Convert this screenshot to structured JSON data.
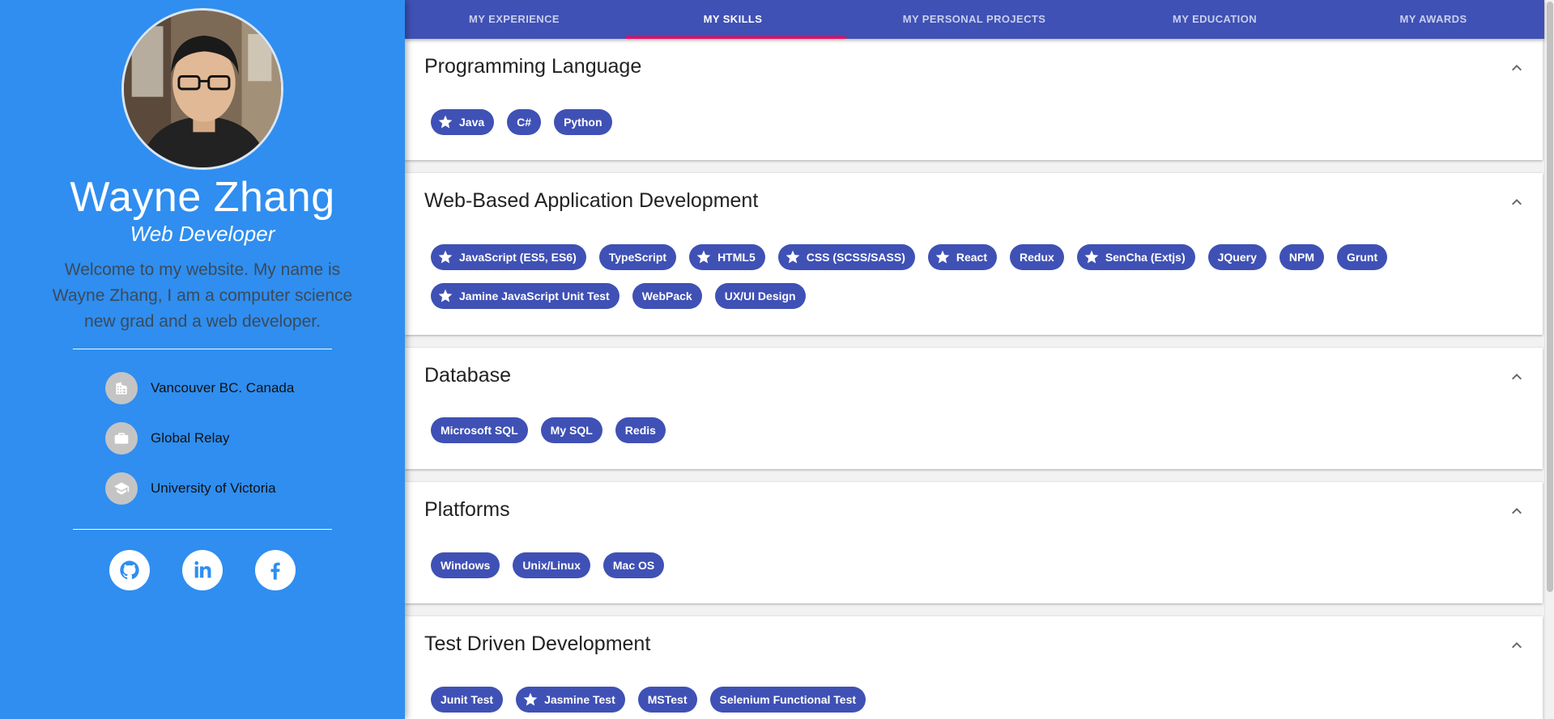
{
  "profile": {
    "name": "Wayne Zhang",
    "role": "Web Developer",
    "bio": "Welcome to my website. My name is Wayne Zhang, I am a computer science new grad and a web developer.",
    "info": [
      {
        "icon": "building-icon",
        "text": "Vancouver BC. Canada"
      },
      {
        "icon": "briefcase-icon",
        "text": "Global Relay"
      },
      {
        "icon": "graduation-cap-icon",
        "text": "University of Victoria"
      }
    ],
    "social": [
      "github-icon",
      "linkedin-icon",
      "facebook-icon"
    ]
  },
  "nav": {
    "tabs": [
      "MY EXPERIENCE",
      "MY SKILLS",
      "MY PERSONAL PROJECTS",
      "MY EDUCATION",
      "MY AWARDS"
    ],
    "active": "MY SKILLS"
  },
  "skills": [
    {
      "title": "Programming Language",
      "chips": [
        {
          "label": "Java",
          "star": true
        },
        {
          "label": "C#",
          "star": false
        },
        {
          "label": "Python",
          "star": false
        }
      ]
    },
    {
      "title": "Web-Based Application Development",
      "chips": [
        {
          "label": "JavaScript (ES5, ES6)",
          "star": true
        },
        {
          "label": "TypeScript",
          "star": false
        },
        {
          "label": "HTML5",
          "star": true
        },
        {
          "label": "CSS (SCSS/SASS)",
          "star": true
        },
        {
          "label": "React",
          "star": true
        },
        {
          "label": "Redux",
          "star": false
        },
        {
          "label": "SenCha (Extjs)",
          "star": true
        },
        {
          "label": "JQuery",
          "star": false
        },
        {
          "label": "NPM",
          "star": false
        },
        {
          "label": "Grunt",
          "star": false
        },
        {
          "label": "Jamine JavaScript Unit Test",
          "star": true
        },
        {
          "label": "WebPack",
          "star": false
        },
        {
          "label": "UX/UI Design",
          "star": false
        }
      ]
    },
    {
      "title": "Database",
      "chips": [
        {
          "label": "Microsoft SQL",
          "star": false
        },
        {
          "label": "My SQL",
          "star": false
        },
        {
          "label": "Redis",
          "star": false
        }
      ]
    },
    {
      "title": "Platforms",
      "chips": [
        {
          "label": "Windows",
          "star": false
        },
        {
          "label": "Unix/Linux",
          "star": false
        },
        {
          "label": "Mac OS",
          "star": false
        }
      ]
    },
    {
      "title": "Test Driven Development",
      "chips": [
        {
          "label": "Junit Test",
          "star": false
        },
        {
          "label": "Jasmine Test",
          "star": true
        },
        {
          "label": "MSTest",
          "star": false
        },
        {
          "label": "Selenium Functional Test",
          "star": false
        }
      ]
    }
  ],
  "colors": {
    "sidebar": "#2f8ef0",
    "primary": "#3f51b5",
    "indicator": "#f50057"
  }
}
